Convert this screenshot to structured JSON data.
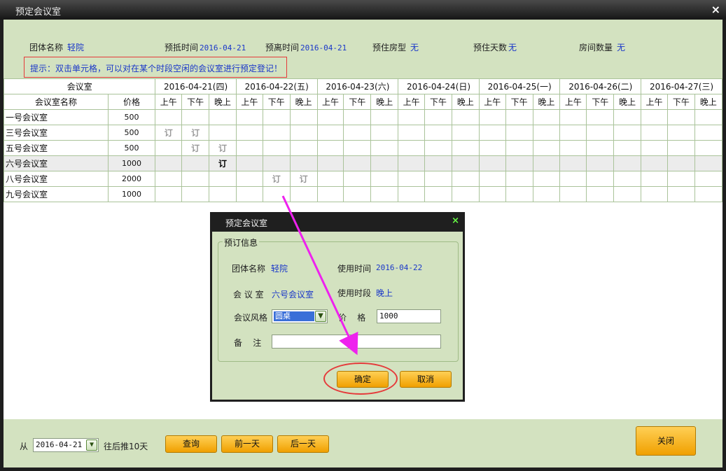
{
  "window": {
    "title": "预定会议室",
    "close_label": "×"
  },
  "info": {
    "group_label": "团体名称",
    "group_value": "轻院",
    "arrive_label": "预抵时间",
    "arrive_value": "2016-04-21",
    "leave_label": "预离时间",
    "leave_value": "2016-04-21",
    "room_type_label": "预住房型",
    "room_type_value": "无",
    "days_label": "预住天数",
    "days_value": "无",
    "room_count_label": "房间数量",
    "room_count_value": "无",
    "hint": "提示：双击单元格，可以对在某个时段空闲的会议室进行预定登记！"
  },
  "grid": {
    "room_header": "会议室",
    "name_header": "会议室名称",
    "price_header": "价格",
    "days": [
      "2016-04-21(四)",
      "2016-04-22(五)",
      "2016-04-23(六)",
      "2016-04-24(日)",
      "2016-04-25(一)",
      "2016-04-26(二)",
      "2016-04-27(三)"
    ],
    "slot_am": "上午",
    "slot_pm": "下午",
    "slot_eve": "晚上",
    "booked_mark": "订",
    "rooms": [
      {
        "name": "一号会议室",
        "price": "500",
        "booked": []
      },
      {
        "name": "三号会议室",
        "price": "500",
        "booked": [
          0,
          1
        ]
      },
      {
        "name": "五号会议室",
        "price": "500",
        "booked": [
          1,
          2
        ]
      },
      {
        "name": "六号会议室",
        "price": "1000",
        "booked": [
          2
        ],
        "strong": [
          2
        ]
      },
      {
        "name": "八号会议室",
        "price": "2000",
        "booked": [
          4,
          5
        ]
      },
      {
        "name": "九号会议室",
        "price": "1000",
        "booked": []
      }
    ]
  },
  "footer": {
    "from_label": "从",
    "from_value": "2016-04-21",
    "after_label": "往后推10天",
    "query_label": "查询",
    "prev_label": "前一天",
    "next_label": "后一天",
    "close_label": "关闭"
  },
  "dialog": {
    "title": "预定会议室",
    "close_label": "×",
    "legend": "预订信息",
    "group_label": "团体名称",
    "group_value": "轻院",
    "use_time_label": "使用时间",
    "use_time_value": "2016-04-22",
    "room_label": "会 议 室",
    "room_value": "六号会议室",
    "period_label": "使用时段",
    "period_value": "晚上",
    "style_label": "会议风格",
    "style_value": "圆桌",
    "price_label": "价    格",
    "price_value": "1000",
    "note_label": "备    注",
    "note_value": "",
    "ok_label": "确定",
    "cancel_label": "取消"
  },
  "colors": {
    "panel": "#d3e2c0",
    "accent_blue": "#1a37c9",
    "button_orange": "#f0a000",
    "annotation_red": "#e53a3a",
    "annotation_magenta": "#ee22ee"
  }
}
